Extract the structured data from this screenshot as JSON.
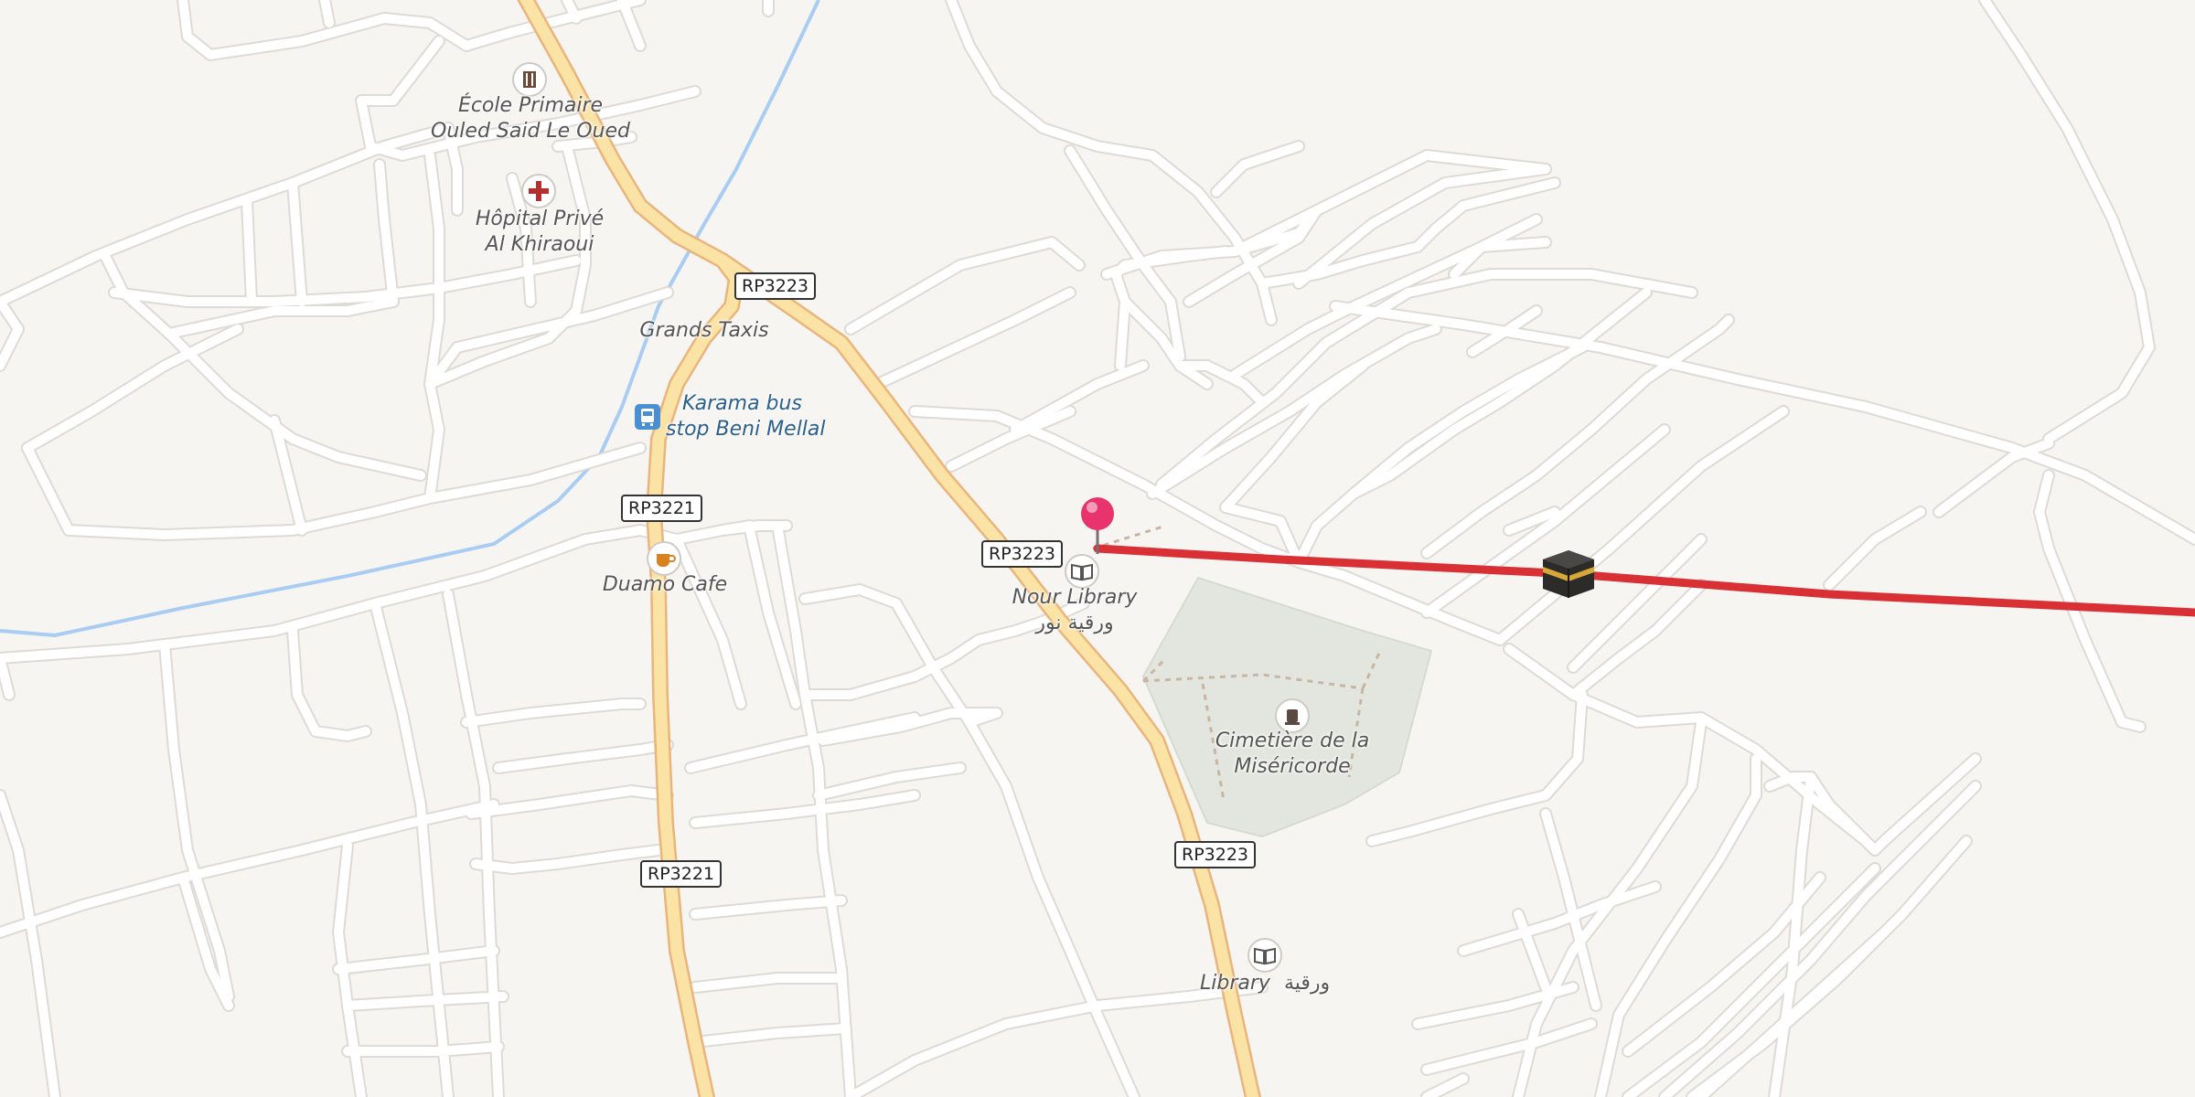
{
  "map": {
    "colors": {
      "background": "#f7f5f2",
      "road_minor": "#ffffff",
      "road_casing": "#dedad5",
      "road_primary": "#fbe3a6",
      "road_primary_casing": "#e9b57c",
      "waterway": "#a9cdf2",
      "cemetery": "#e3e6df",
      "route": "#d93036",
      "pin": "#e8336f"
    },
    "icons": {
      "pin": "map-pin-icon",
      "destination": "kaaba-icon",
      "route": "route-line"
    }
  },
  "road_refs": {
    "rp3223_north": "RP3223",
    "rp3223_center": "RP3223",
    "rp3223_south": "RP3223",
    "rp3221_north": "RP3221",
    "rp3221_south": "RP3221"
  },
  "pois": {
    "school": {
      "line1": "École Primaire",
      "line2": "Ouled Said Le Oued",
      "icon": "school-icon"
    },
    "hospital": {
      "line1": "Hôpital Privé",
      "line2": "Al Khiraoui",
      "icon": "hospital-cross-icon"
    },
    "taxis": {
      "name": "Grands Taxis"
    },
    "bus_stop": {
      "line1": "Karama bus",
      "line2": "stop Beni Mellal",
      "icon": "bus-stop-icon"
    },
    "cafe": {
      "name": "Duamo Cafe",
      "icon": "coffee-cup-icon"
    },
    "nour_library": {
      "name": "Nour Library",
      "name_ar": "ورقية نور",
      "icon": "book-icon"
    },
    "cemetery": {
      "line1": "Cimetière de la",
      "line2": "Miséricorde",
      "icon": "grave-icon"
    },
    "library": {
      "name": "Library",
      "name_ar": "ورقية",
      "icon": "book-icon"
    }
  }
}
